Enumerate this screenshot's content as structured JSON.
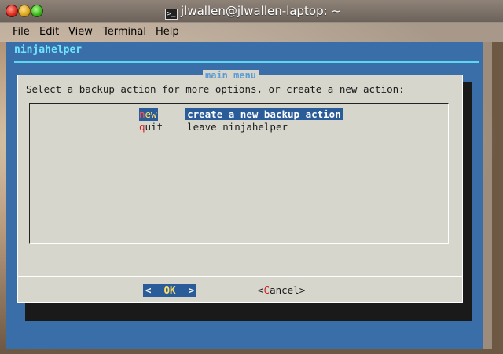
{
  "window": {
    "title": "jlwallen@jlwallen-laptop: ~",
    "icon": "terminal-icon"
  },
  "menubar": {
    "items": [
      "File",
      "Edit",
      "View",
      "Terminal",
      "Help"
    ]
  },
  "app": {
    "title": "ninjahelper"
  },
  "dialog": {
    "title": "main menu",
    "prompt": "Select a backup action for more options, or create a new action:",
    "items": [
      {
        "tag_hot": "n",
        "tag_rest": "ew",
        "description": "create a new backup action",
        "selected": true
      },
      {
        "tag_hot": "q",
        "tag_rest": "uit",
        "description": "leave ninjahelper",
        "selected": false
      }
    ],
    "ok": {
      "left": "<",
      "label": "OK",
      "right": ">"
    },
    "cancel": {
      "open": "<",
      "hot": "C",
      "rest": "ancel",
      "close": ">"
    }
  },
  "colors": {
    "terminal_bg": "#3a6ea8",
    "dialog_bg": "#d6d6cc",
    "selection": "#2b5c9a",
    "app_title": "#6fe6ff",
    "hotkey": "#d0202a"
  }
}
